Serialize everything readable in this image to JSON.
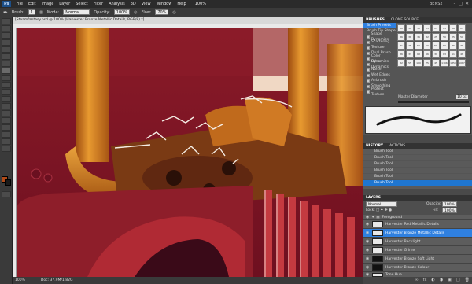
{
  "app": {
    "logo": "Ps",
    "menu": [
      "File",
      "Edit",
      "Image",
      "Layer",
      "Select",
      "Filter",
      "Analysis",
      "3D",
      "View",
      "Window",
      "Help"
    ],
    "zoom": "100%",
    "workspace": "BENS2"
  },
  "options": {
    "tool_label": "Brush:",
    "brush_size": "1",
    "mode_label": "Mode:",
    "mode_value": "Normal",
    "opacity_label": "Opacity:",
    "opacity_value": "100%",
    "flow_label": "Flow:",
    "flow_value": "70%"
  },
  "document": {
    "title": "[Steamfantasy.psd @ 100% (Harvester Bronze Metallic Details, RGB/8) *]",
    "zoom": "100%",
    "doc_size": "Doc: 37.9M/1.82G"
  },
  "brushes_panel": {
    "tabs": [
      "BRUSHES",
      "CLONE SOURCE"
    ],
    "items": [
      "Brush Presets",
      "Brush Tip Shape",
      "Shape Dynamics",
      "Scattering",
      "Texture",
      "Dual Brush",
      "Color Dynamics",
      "Other Dynamics",
      "Noise",
      "Wet Edges",
      "Airbrush",
      "Smoothing",
      "Protect Texture"
    ],
    "tips": [
      "30",
      "30",
      "30",
      "25",
      "25",
      "25",
      "36",
      "25",
      "36",
      "36",
      "36",
      "32",
      "25",
      "50",
      "25",
      "50",
      "71",
      "25",
      "50",
      "50",
      "50",
      "50",
      "36",
      "36",
      "36",
      "33",
      "63",
      "66",
      "39",
      "63",
      "11",
      "48",
      "32",
      "55",
      "100",
      "75",
      "45",
      "1106",
      "1850",
      "1067"
    ],
    "master_diameter_label": "Master Diameter",
    "master_diameter_value": "10 px"
  },
  "history_panel": {
    "tabs": [
      "HISTORY",
      "ACTIONS"
    ],
    "rows": [
      "Brush Tool",
      "Brush Tool",
      "Brush Tool",
      "Brush Tool",
      "Brush Tool",
      "Brush Tool"
    ]
  },
  "layers_panel": {
    "tab": "LAYERS",
    "blend_mode": "Normal",
    "opacity_label": "Opacity:",
    "opacity_value": "100%",
    "lock_label": "Lock:",
    "fill_label": "Fill:",
    "fill_value": "100%",
    "layers": [
      {
        "name": "Foreground",
        "group": true
      },
      {
        "name": "Harvester Red Metallic Details",
        "group": false
      },
      {
        "name": "Harvester Bronze Metallic Details",
        "group": false
      },
      {
        "name": "Harvester Backlight",
        "group": false
      },
      {
        "name": "Harvester Grime",
        "group": false
      },
      {
        "name": "Harvester Bronze Soft Light",
        "group": false
      },
      {
        "name": "Harvester Bronze Colour",
        "group": false
      },
      {
        "name": "Tone Hue",
        "group": false
      }
    ]
  }
}
